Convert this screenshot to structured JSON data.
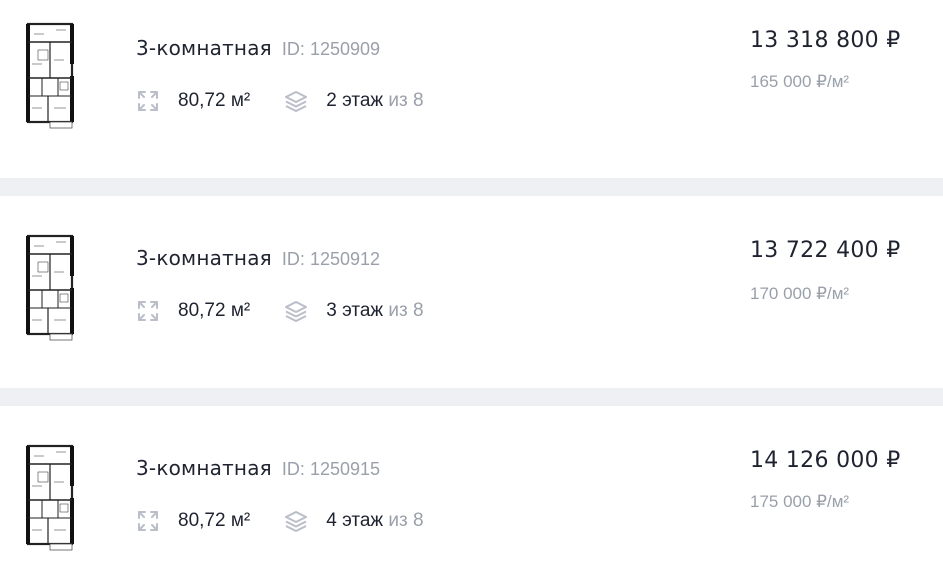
{
  "listings": [
    {
      "rooms": "3-комнатная",
      "id_label": "ID:",
      "id": "1250909",
      "area": "80,72 м²",
      "floor": "2 этаж",
      "floor_of": "из 8",
      "price": "13 318 800 ₽",
      "price_per_m2": "165 000 ₽/м²",
      "area_icon": "expand-icon",
      "floor_icon": "layers-icon",
      "plan_image": "floor-plan-thumbnail"
    },
    {
      "rooms": "3-комнатная",
      "id_label": "ID:",
      "id": "1250912",
      "area": "80,72 м²",
      "floor": "3 этаж",
      "floor_of": "из 8",
      "price": "13 722 400 ₽",
      "price_per_m2": "170 000 ₽/м²",
      "area_icon": "expand-icon",
      "floor_icon": "layers-icon",
      "plan_image": "floor-plan-thumbnail"
    },
    {
      "rooms": "3-комнатная",
      "id_label": "ID:",
      "id": "1250915",
      "area": "80,72 м²",
      "floor": "4 этаж",
      "floor_of": "из 8",
      "price": "14 126 000 ₽",
      "price_per_m2": "175 000 ₽/м²",
      "area_icon": "expand-icon",
      "floor_icon": "layers-icon",
      "plan_image": "floor-plan-thumbnail"
    }
  ],
  "colors": {
    "text": "#1f2330",
    "muted": "#9aa0aa",
    "separator": "#eef0f4",
    "icon": "#b9bec8"
  }
}
